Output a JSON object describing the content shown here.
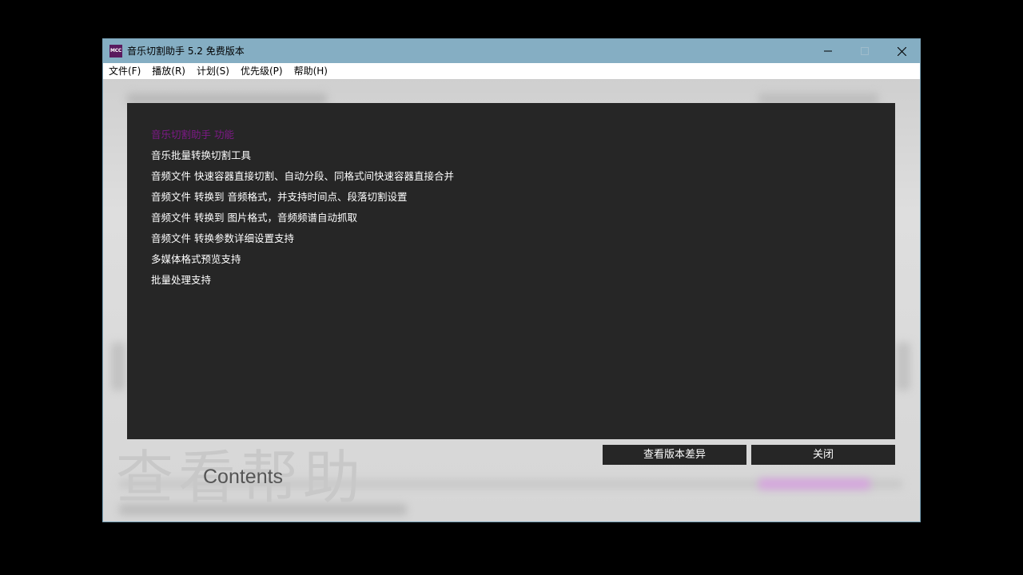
{
  "window": {
    "title": "音乐切割助手 5.2 免费版本",
    "icon_text": "MCC",
    "icon_name": "app-logo-icon",
    "controls": {
      "minimize_icon": "minimize-icon",
      "maximize_icon": "maximize-icon",
      "close_icon": "close-icon"
    }
  },
  "menu": {
    "items": [
      {
        "label": "文件(F)"
      },
      {
        "label": "播放(R)"
      },
      {
        "label": "计划(S)"
      },
      {
        "label": "优先级(P)"
      },
      {
        "label": "帮助(H)"
      }
    ]
  },
  "background": {
    "watermark": "查看帮助",
    "contents_label": "Contents"
  },
  "help_panel": {
    "heading": "音乐切割助手 功能",
    "lines": [
      "音乐批量转换切割工具",
      "音频文件 快速容器直接切割、自动分段、同格式间快速容器直接合并",
      "音频文件 转换到 音频格式，并支持时间点、段落切割设置",
      "音频文件 转换到 图片格式，音频频谱自动抓取",
      "音频文件 转换参数详细设置支持",
      "多媒体格式预览支持",
      "批量处理支持"
    ]
  },
  "buttons": {
    "view_diff": "查看版本差异",
    "close": "关闭"
  },
  "colors": {
    "titlebar": "#85aec3",
    "panel": "#262626",
    "heading": "#7d1a86",
    "accent_button": "#262626"
  }
}
